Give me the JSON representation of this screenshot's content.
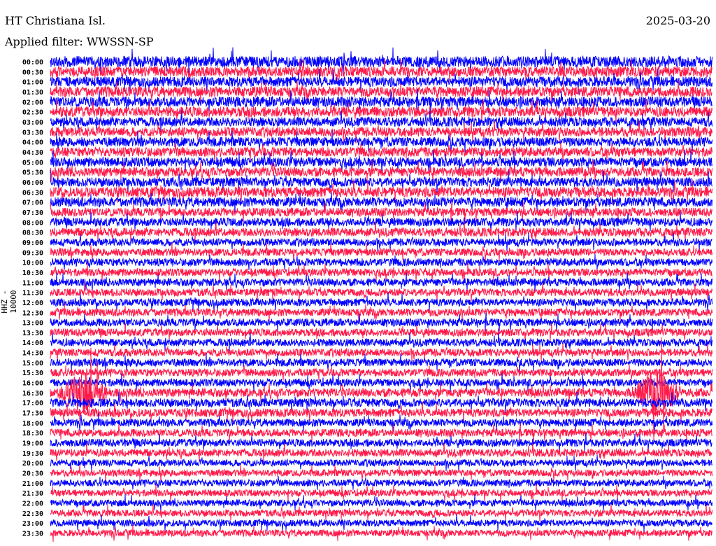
{
  "header": {
    "station": "HT Christiana Isl.",
    "date": "2025-03-20",
    "filter": "Applied filter: WWSSN-SP"
  },
  "chart_data": {
    "type": "line",
    "title": "HT Christiana Isl.",
    "subtitle": "Applied filter: WWSSN-SP",
    "ylabel": "HHZ - 10000",
    "xlabel": "",
    "row_labels": [
      "00:00",
      "00:30",
      "01:00",
      "01:30",
      "02:00",
      "02:30",
      "03:00",
      "03:30",
      "04:00",
      "04:30",
      "05:00",
      "05:30",
      "06:00",
      "06:30",
      "07:00",
      "07:30",
      "08:00",
      "08:30",
      "09:00",
      "09:30",
      "10:00",
      "10:30",
      "11:00",
      "11:30",
      "12:00",
      "12:30",
      "13:00",
      "13:30",
      "14:00",
      "14:30",
      "15:00",
      "15:30",
      "16:00",
      "16:30",
      "17:00",
      "17:30",
      "18:00",
      "18:30",
      "19:00",
      "19:30",
      "20:00",
      "20:30",
      "21:00",
      "21:30",
      "22:00",
      "22:30",
      "23:00",
      "23:30"
    ],
    "series_colors": [
      "#0000ff",
      "#ff1a4a"
    ],
    "row_minutes": 30,
    "noise_level": [
      1.3,
      1.2,
      1.2,
      1.2,
      1.2,
      1.2,
      1.1,
      1.1,
      1.1,
      1.1,
      1.1,
      1.1,
      1.1,
      1.2,
      1.1,
      1.0,
      1.0,
      1.0,
      0.9,
      0.9,
      0.9,
      0.9,
      0.9,
      0.9,
      0.9,
      0.9,
      0.9,
      0.9,
      0.9,
      0.9,
      0.9,
      0.9,
      0.9,
      1.0,
      1.0,
      1.0,
      0.9,
      0.9,
      0.9,
      0.9,
      0.8,
      0.8,
      0.8,
      0.8,
      0.8,
      0.8,
      0.8,
      0.8
    ],
    "events": [
      {
        "row": "16:30",
        "minute": 1.5,
        "strength": 2.2
      },
      {
        "row": "16:30",
        "minute": 27.5,
        "strength": 2.6
      }
    ]
  }
}
